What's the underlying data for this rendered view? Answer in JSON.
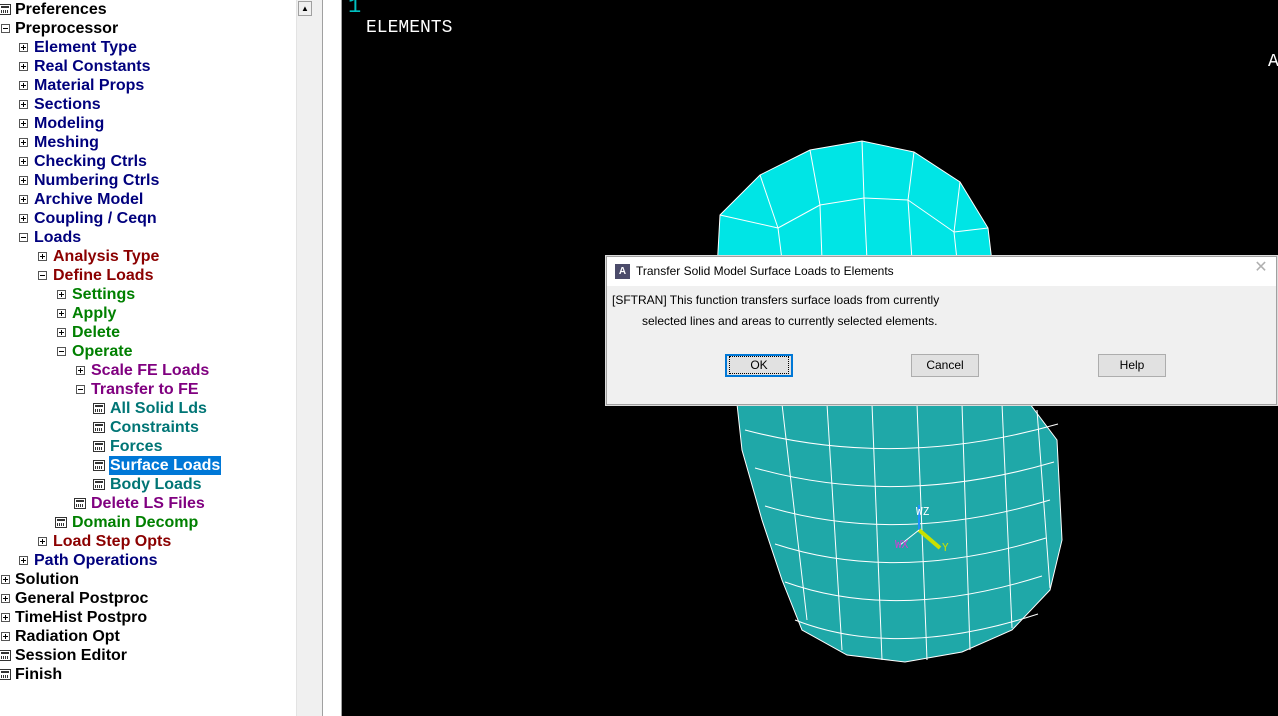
{
  "tree": {
    "items": [
      {
        "label": "Preferences",
        "icon": "leaf",
        "color": "black"
      },
      {
        "label": "Preprocessor",
        "icon": "collapse",
        "color": "black"
      },
      {
        "label": "Element Type",
        "icon": "expand",
        "color": "navy"
      },
      {
        "label": "Real Constants",
        "icon": "expand",
        "color": "navy"
      },
      {
        "label": "Material Props",
        "icon": "expand",
        "color": "navy"
      },
      {
        "label": "Sections",
        "icon": "expand",
        "color": "navy"
      },
      {
        "label": "Modeling",
        "icon": "expand",
        "color": "navy"
      },
      {
        "label": "Meshing",
        "icon": "expand",
        "color": "navy"
      },
      {
        "label": "Checking Ctrls",
        "icon": "expand",
        "color": "navy"
      },
      {
        "label": "Numbering Ctrls",
        "icon": "expand",
        "color": "navy"
      },
      {
        "label": "Archive Model",
        "icon": "expand",
        "color": "navy"
      },
      {
        "label": "Coupling / Ceqn",
        "icon": "expand",
        "color": "navy"
      },
      {
        "label": "Loads",
        "icon": "collapse",
        "color": "navy"
      },
      {
        "label": "Analysis Type",
        "icon": "expand",
        "color": "maroon"
      },
      {
        "label": "Define Loads",
        "icon": "collapse",
        "color": "maroon"
      },
      {
        "label": "Settings",
        "icon": "expand",
        "color": "green"
      },
      {
        "label": "Apply",
        "icon": "expand",
        "color": "green"
      },
      {
        "label": "Delete",
        "icon": "expand",
        "color": "green"
      },
      {
        "label": "Operate",
        "icon": "collapse",
        "color": "green"
      },
      {
        "label": "Scale FE Loads",
        "icon": "expand",
        "color": "purple"
      },
      {
        "label": "Transfer to FE",
        "icon": "collapse",
        "color": "purple"
      },
      {
        "label": "All Solid Lds",
        "icon": "leaf",
        "color": "teal"
      },
      {
        "label": "Constraints",
        "icon": "leaf",
        "color": "teal"
      },
      {
        "label": "Forces",
        "icon": "leaf",
        "color": "teal"
      },
      {
        "label": "Surface Loads",
        "icon": "leaf",
        "color": "teal",
        "selected": true
      },
      {
        "label": "Body Loads",
        "icon": "leaf",
        "color": "teal"
      },
      {
        "label": "Delete LS Files",
        "icon": "leaf",
        "color": "purple"
      },
      {
        "label": "Domain Decomp",
        "icon": "leaf",
        "color": "green"
      },
      {
        "label": "Load Step Opts",
        "icon": "expand",
        "color": "maroon"
      },
      {
        "label": "Path Operations",
        "icon": "expand",
        "color": "navy"
      },
      {
        "label": "Solution",
        "icon": "expand",
        "color": "black"
      },
      {
        "label": "General Postproc",
        "icon": "expand",
        "color": "black"
      },
      {
        "label": "TimeHist Postpro",
        "icon": "expand",
        "color": "black"
      },
      {
        "label": "Radiation Opt",
        "icon": "expand",
        "color": "black"
      },
      {
        "label": "Session Editor",
        "icon": "leaf",
        "color": "black"
      },
      {
        "label": "Finish",
        "icon": "leaf",
        "color": "black"
      }
    ]
  },
  "graphics": {
    "window_number": "1",
    "plot_title": "ELEMENTS",
    "corner_label": "A",
    "triad": {
      "wz": "WZ",
      "wx": "WX",
      "y": "Y"
    },
    "mesh_color": "#00e5e5",
    "mesh_shade_color": "#1fa8a8"
  },
  "dialog": {
    "title": "Transfer Solid Model Surface Loads to Elements",
    "app_icon": "A",
    "line1": "[SFTRAN]  This function transfers surface loads from currently",
    "line2": "selected lines and areas to currently selected elements.",
    "ok_label": "OK",
    "cancel_label": "Cancel",
    "help_label": "Help"
  }
}
